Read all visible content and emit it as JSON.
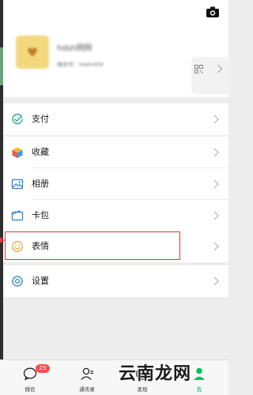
{
  "profile": {
    "nickname": "hdsh网网",
    "wxid": "微信号：hdsh459"
  },
  "menu": {
    "pay_label": "支付",
    "favorites_label": "收藏",
    "album_label": "相册",
    "cards_label": "卡包",
    "sticker_label": "表情",
    "settings_label": "设置"
  },
  "tabbar": {
    "chats_label": "微信",
    "chats_badge": "25",
    "contacts_label": "通讯录",
    "discover_label": "发现",
    "me_label": "我"
  },
  "watermark": "云南龙网",
  "colors": {
    "accent": "#07c160",
    "highlight": "#d63b3b",
    "badge": "#f45151"
  }
}
